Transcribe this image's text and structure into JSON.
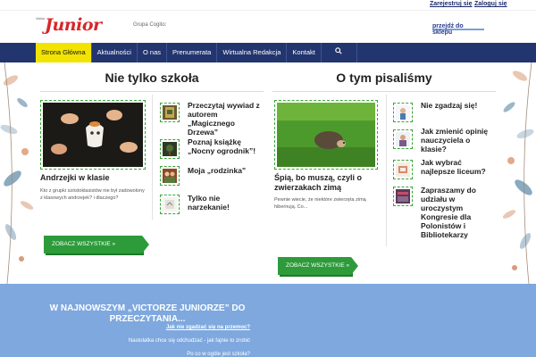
{
  "topbar": {
    "register": "Zarejestruj się",
    "login": "Zaloguj się"
  },
  "header": {
    "logo_small": "Victor",
    "logo_text": "Junior",
    "grupa_label": "Grupa Cogito:",
    "partner_label": "przejdź do sklepu"
  },
  "nav": {
    "items": [
      {
        "label": "Strona Główna",
        "active": true
      },
      {
        "label": "Aktualności"
      },
      {
        "label": "O nas"
      },
      {
        "label": "Prenumerata"
      },
      {
        "label": "Wirtualna Redakcja"
      },
      {
        "label": "Kontakt"
      }
    ],
    "search_icon": "search-icon"
  },
  "left_section": {
    "title": "Nie tylko szkoła",
    "feature": {
      "title": "Andrzejki w klasie",
      "desc": "Kto z grupki szóstoklasistów nie był zadowolony z klasowych andrzejek? i dlaczego?"
    },
    "side": [
      {
        "title": "Przeczytaj wywiad z autorem „Magicznego Drzewa”"
      },
      {
        "title": "Poznaj książkę „Nocny ogrodnik”!"
      },
      {
        "title": "Moja „rodzinka”"
      },
      {
        "title": "Tylko nie narzekanie!"
      }
    ],
    "more": "ZOBACZ WSZYSTKIE »"
  },
  "right_section": {
    "title": "O tym pisaliśmy",
    "feature": {
      "title": "Śpią, bo muszą, czyli o zwierzakach zimą",
      "desc": "Pewnie wiecie, że niektóre zwierzęta zimą hibernują. Co..."
    },
    "side": [
      {
        "title": "Nie zgadzaj się!"
      },
      {
        "title": "Jak zmienić opinię nauczyciela o klasie?"
      },
      {
        "title": "Jak wybrać najlepsze liceum?"
      },
      {
        "title": "Zapraszamy do udziału w uroczystym Kongresie dla Polonistów i Bibliotekarzy"
      }
    ],
    "more": "ZOBACZ WSZYSTKIE »"
  },
  "bottom": {
    "title": "W najnowszym „Victorze Juniorze” do przeczytania...",
    "links": [
      "Jak nie zgadzać się na przemoc?",
      "Nastolatka chce się odchudzać - jak fajnie to zrobić",
      "Po co w ogóle jest szkoła?"
    ]
  },
  "colors": {
    "nav_bg": "#22356e",
    "nav_active": "#f2e400",
    "accent_green": "#2d9b3a",
    "logo_red": "#d8262a",
    "bottom_band": "#7ea8de"
  }
}
